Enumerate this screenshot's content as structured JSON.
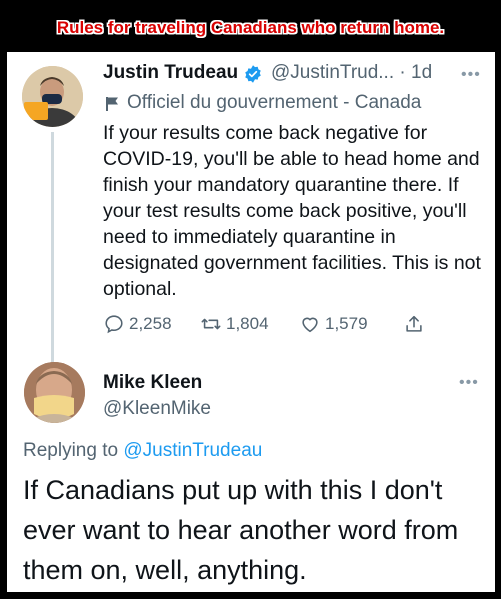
{
  "banner": {
    "title": "Rules for traveling Canadians who return home."
  },
  "tweet": {
    "author_name": "Justin Trudeau",
    "author_handle": "@JustinTrud...",
    "time": "· 1d",
    "more_icon": "more-icon",
    "verified_icon": "verified-badge-icon",
    "gov_label_icon": "flag-icon",
    "gov_label": "Officiel du gouvernement - Canada",
    "text": "If your results come back negative for COVID-19, you'll be able to head home and finish your mandatory quarantine there. If your test results come back positive, you'll need to immediately quarantine in designated government facilities. This is not optional.",
    "actions": {
      "reply_count": "2,258",
      "retweet_count": "1,804",
      "like_count": "1,579"
    }
  },
  "reply": {
    "author_name": "Mike Kleen",
    "author_handle": "@KleenMike",
    "replying_prefix": "Replying to ",
    "replying_to": "@JustinTrudeau",
    "text": "If Canadians put up with this I don't ever want to hear another word from them on, well, anything."
  },
  "colors": {
    "banner_text": "#d80000",
    "accent": "#1d9bf0",
    "secondary_text": "#536471"
  }
}
